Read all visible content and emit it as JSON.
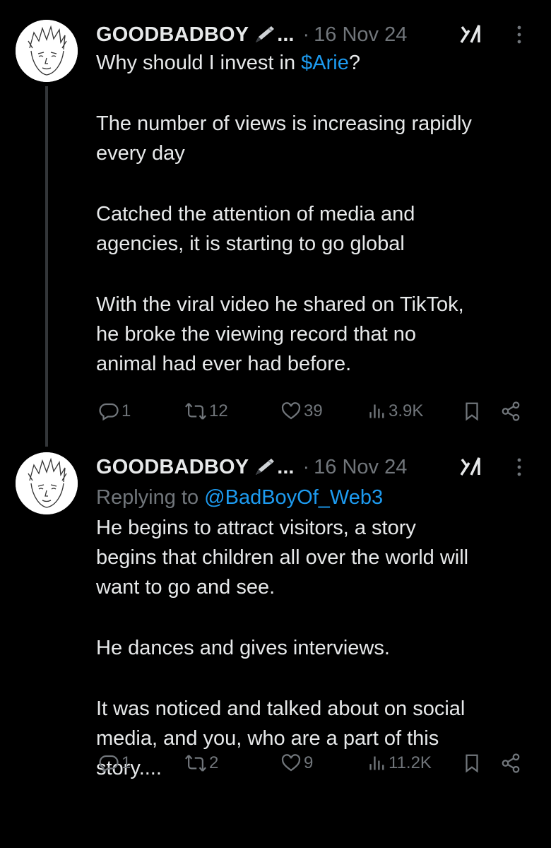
{
  "tweets": [
    {
      "author": "GOODBADBOY",
      "ellipsis": "...",
      "separator": "·",
      "date": "16 Nov 24",
      "lines_before": "Why should I invest in ",
      "cashtag": "$Arie",
      "lines_after": "?",
      "paragraphs": [
        [
          "The number of views is increasing rapidly",
          "every day"
        ],
        [
          "Catched the attention of media and",
          "agencies, it is starting to go global"
        ],
        [
          "With the viral video he shared on TikTok,",
          "he broke the viewing record that no",
          "animal had ever had before."
        ]
      ],
      "replies": "1",
      "reposts": "12",
      "likes": "39",
      "views": "3.9K"
    },
    {
      "author": "GOODBADBOY",
      "ellipsis": "...",
      "separator": "·",
      "date": "16 Nov 24",
      "replying_prefix": "Replying to ",
      "replying_handle": "@BadBoyOf_Web3",
      "paragraphs": [
        [
          "He begins to attract visitors, a story",
          "begins that children all over the world will",
          "want to go and see."
        ],
        [
          "He dances and gives interviews."
        ],
        [
          "It was noticed and talked about on social",
          "media, and you, who are a part of this",
          "story...."
        ]
      ],
      "replies": "1",
      "reposts": "2",
      "likes": "9",
      "views": "11.2K"
    }
  ],
  "colors": {
    "background": "#000000",
    "text": "#e7e9ea",
    "muted": "#71767b",
    "link": "#1d9bf0",
    "thread_line": "#333639"
  },
  "icons": [
    "pen-icon",
    "grok-icon",
    "more-icon",
    "reply-icon",
    "repost-icon",
    "like-icon",
    "views-icon",
    "bookmark-icon",
    "share-icon"
  ]
}
